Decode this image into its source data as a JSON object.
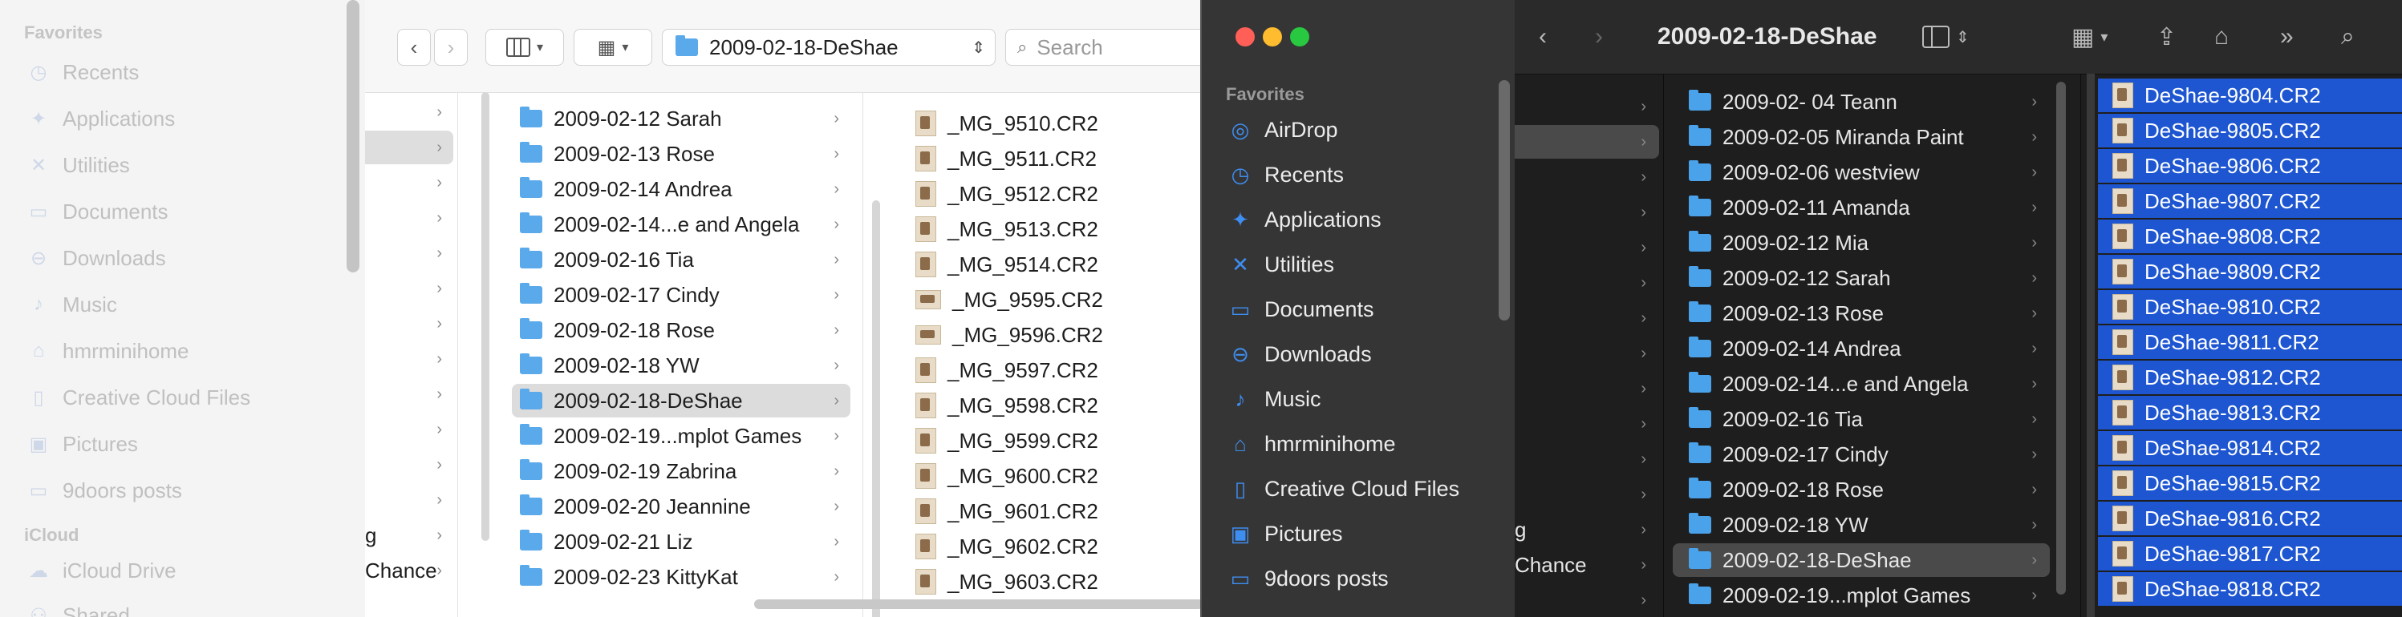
{
  "left_window": {
    "sidebar": {
      "favorites_heading": "Favorites",
      "favorites": [
        {
          "label": "Recents",
          "icon": "clock-icon"
        },
        {
          "label": "Applications",
          "icon": "applications-icon"
        },
        {
          "label": "Utilities",
          "icon": "utilities-icon"
        },
        {
          "label": "Documents",
          "icon": "document-icon"
        },
        {
          "label": "Downloads",
          "icon": "download-icon"
        },
        {
          "label": "Music",
          "icon": "music-icon"
        },
        {
          "label": "hmrminihome",
          "icon": "home-icon"
        },
        {
          "label": "Creative Cloud Files",
          "icon": "file-icon"
        },
        {
          "label": "Pictures",
          "icon": "pictures-icon"
        },
        {
          "label": "9doors posts",
          "icon": "folder-icon"
        }
      ],
      "icloud_heading": "iCloud",
      "icloud": [
        {
          "label": "iCloud Drive",
          "icon": "cloud-icon"
        },
        {
          "label": "Shared",
          "icon": "shared-icon"
        }
      ]
    },
    "toolbar": {
      "back": "‹",
      "forward": "›",
      "path_folder": "2009-02-18-DeShae",
      "search_placeholder": "Search"
    },
    "column1_fragments": [
      "g",
      "Chance"
    ],
    "column2": [
      "2009-02-12 Sarah",
      "2009-02-13 Rose",
      "2009-02-14 Andrea",
      "2009-02-14...e and Angela",
      "2009-02-16 Tia",
      "2009-02-17 Cindy",
      "2009-02-18 Rose",
      "2009-02-18 YW",
      "2009-02-18-DeShae",
      "2009-02-19...mplot Games",
      "2009-02-19 Zabrina",
      "2009-02-20 Jeannine",
      "2009-02-21 Liz",
      "2009-02-23 KittyKat"
    ],
    "column2_selected_index": 8,
    "column3": [
      {
        "name": "_MG_9510.CR2",
        "orient": "portrait"
      },
      {
        "name": "_MG_9511.CR2",
        "orient": "portrait"
      },
      {
        "name": "_MG_9512.CR2",
        "orient": "portrait"
      },
      {
        "name": "_MG_9513.CR2",
        "orient": "portrait"
      },
      {
        "name": "_MG_9514.CR2",
        "orient": "portrait"
      },
      {
        "name": "_MG_9595.CR2",
        "orient": "landscape"
      },
      {
        "name": "_MG_9596.CR2",
        "orient": "landscape"
      },
      {
        "name": "_MG_9597.CR2",
        "orient": "portrait"
      },
      {
        "name": "_MG_9598.CR2",
        "orient": "portrait"
      },
      {
        "name": "_MG_9599.CR2",
        "orient": "portrait"
      },
      {
        "name": "_MG_9600.CR2",
        "orient": "portrait"
      },
      {
        "name": "_MG_9601.CR2",
        "orient": "portrait"
      },
      {
        "name": "_MG_9602.CR2",
        "orient": "portrait"
      },
      {
        "name": "_MG_9603.CR2",
        "orient": "portrait"
      }
    ]
  },
  "right_window": {
    "title": "2009-02-18-DeShae",
    "traffic_lights": {
      "close": "#ff5f57",
      "minimize": "#febc2e",
      "zoom": "#28c840"
    },
    "sidebar": {
      "favorites_heading": "Favorites",
      "favorites": [
        {
          "label": "AirDrop",
          "icon": "airdrop-icon"
        },
        {
          "label": "Recents",
          "icon": "clock-icon"
        },
        {
          "label": "Applications",
          "icon": "applications-icon"
        },
        {
          "label": "Utilities",
          "icon": "utilities-icon"
        },
        {
          "label": "Documents",
          "icon": "document-icon"
        },
        {
          "label": "Downloads",
          "icon": "download-icon"
        },
        {
          "label": "Music",
          "icon": "music-icon"
        },
        {
          "label": "hmrminihome",
          "icon": "home-icon"
        },
        {
          "label": "Creative Cloud Files",
          "icon": "file-icon"
        },
        {
          "label": "Pictures",
          "icon": "pictures-icon"
        },
        {
          "label": "9doors posts",
          "icon": "folder-icon"
        }
      ]
    },
    "column1_fragments": [
      "g",
      "Chance"
    ],
    "column2": [
      "2009-02- 04 Teann",
      "2009-02-05 Miranda Paint",
      "2009-02-06 westview",
      "2009-02-11 Amanda",
      "2009-02-12 Mia",
      "2009-02-12 Sarah",
      "2009-02-13 Rose",
      "2009-02-14 Andrea",
      "2009-02-14...e and Angela",
      "2009-02-16 Tia",
      "2009-02-17 Cindy",
      "2009-02-18 Rose",
      "2009-02-18 YW",
      "2009-02-18-DeShae",
      "2009-02-19...mplot Games"
    ],
    "column2_selected_index": 13,
    "column3": [
      "DeShae-9804.CR2",
      "DeShae-9805.CR2",
      "DeShae-9806.CR2",
      "DeShae-9807.CR2",
      "DeShae-9808.CR2",
      "DeShae-9809.CR2",
      "DeShae-9810.CR2",
      "DeShae-9811.CR2",
      "DeShae-9812.CR2",
      "DeShae-9813.CR2",
      "DeShae-9814.CR2",
      "DeShae-9815.CR2",
      "DeShae-9816.CR2",
      "DeShae-9817.CR2",
      "DeShae-9818.CR2"
    ],
    "selection_color": "#1e56d1"
  }
}
